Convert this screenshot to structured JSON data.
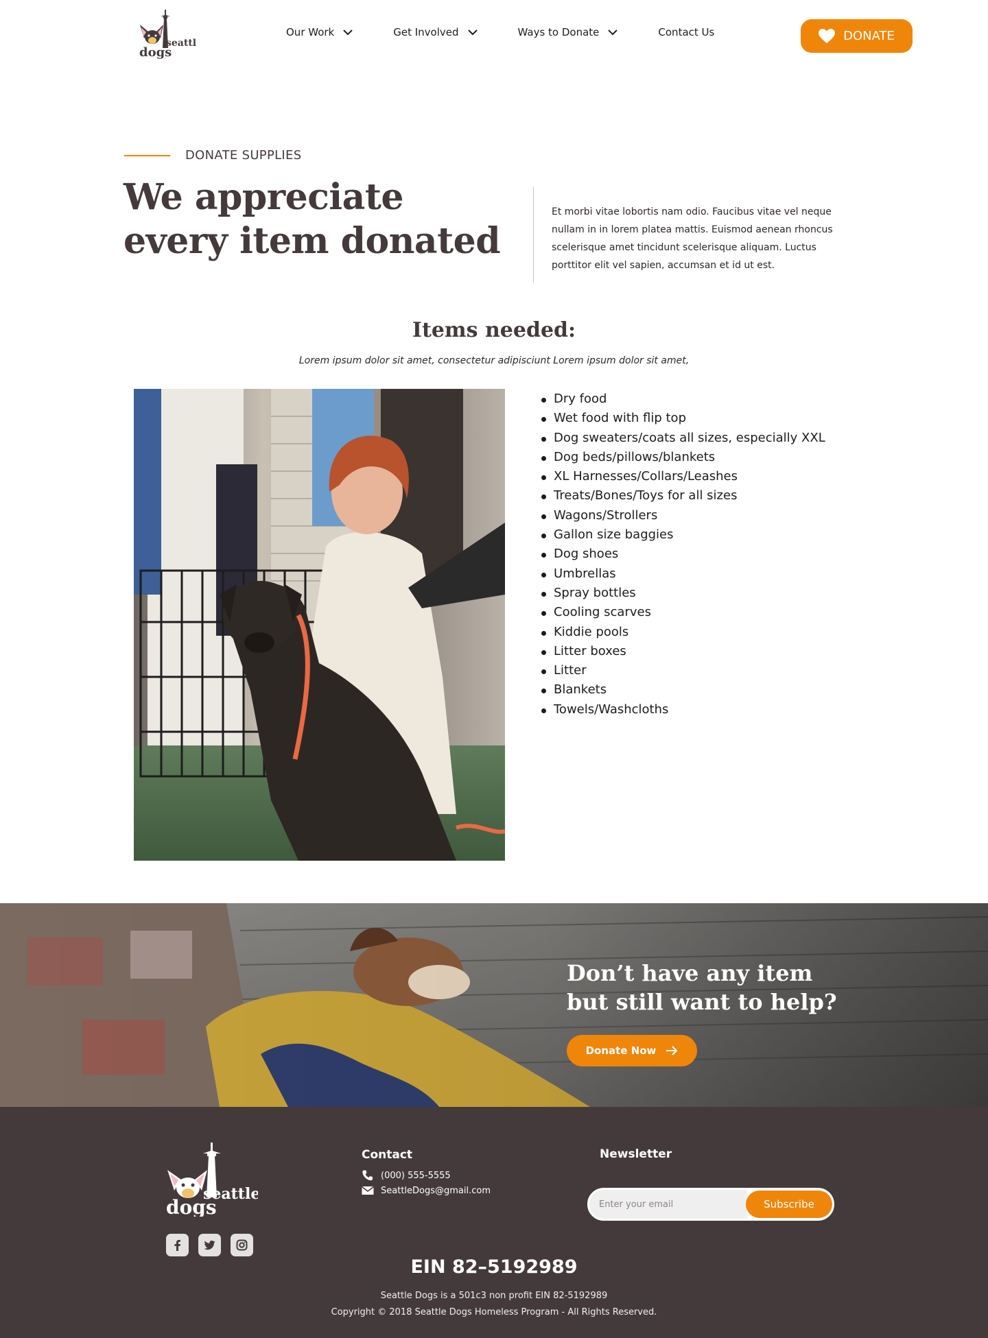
{
  "header": {
    "logo_alt": "seattle dogs",
    "nav": [
      {
        "label": "Our Work",
        "has_dropdown": true
      },
      {
        "label": "Get Involved",
        "has_dropdown": true
      },
      {
        "label": "Ways to Donate",
        "has_dropdown": true
      },
      {
        "label": "Contact Us",
        "has_dropdown": false
      }
    ],
    "donate_label": "DONATE"
  },
  "intro": {
    "eyebrow": "DONATE SUPPLIES",
    "headline": "We appreciate every item donated",
    "text": "Et morbi vitae lobortis nam odio. Faucibus vitae vel neque nullam in in lorem platea mattis. Euismod aenean rhoncus scelerisque amet tincidunt scelerisque aliquam. Luctus porttitor elit vel sapien, accumsan et id ut est."
  },
  "items": {
    "title": "Items needed:",
    "subtitle": "Lorem ipsum dolor sit amet, consectetur adipisciunt Lorem ipsum dolor sit amet,",
    "list": [
      "Dry food",
      "Wet food with flip top",
      "Dog sweaters/coats all sizes, especially XXL",
      "Dog beds/pillows/blankets",
      "XL Harnesses/Collars/Leashes",
      "Treats/Bones/Toys for all sizes",
      "Wagons/Strollers",
      "Gallon size baggies",
      "Dog shoes",
      "Umbrellas",
      "Spray bottles",
      "Cooling scarves",
      "Kiddie pools",
      "Litter boxes",
      "Litter",
      "Blankets",
      "Towels/Washcloths"
    ]
  },
  "banner": {
    "title": "Don’t have any item but still want to help?",
    "button_label": "Donate Now"
  },
  "footer": {
    "contact_title": "Contact",
    "phone": "(000) 555-5555",
    "email": "SeattleDogs@gmail.com",
    "newsletter_title": "Newsletter",
    "email_placeholder": "Enter your email",
    "subscribe_label": "Subscribe",
    "ein": "EIN 82–5192989",
    "nonprofit_note": "Seattle Dogs is a 501c3 non profit EIN 82-5192989",
    "copyright": "Copyright © 2018 Seattle Dogs Homeless Program - All Rights Reserved.",
    "socials": [
      "facebook-icon",
      "twitter-icon",
      "instagram-icon"
    ]
  },
  "colors": {
    "accent": "#ef8609",
    "text": "#443a3c",
    "footer_bg": "#443a3c"
  }
}
